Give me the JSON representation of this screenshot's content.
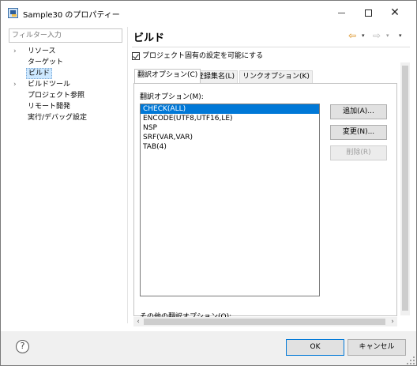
{
  "window": {
    "title": "Sample30 のプロパティー",
    "controls": {
      "minimize": "minimize-icon",
      "maximize": "maximize-icon",
      "close": "✕"
    }
  },
  "filter": {
    "placeholder": "フィルター入力"
  },
  "tree": {
    "items": [
      {
        "label": "リソース",
        "expandable": true,
        "selected": false
      },
      {
        "label": "ターゲット",
        "expandable": false,
        "selected": false
      },
      {
        "label": "ビルド",
        "expandable": false,
        "selected": true
      },
      {
        "label": "ビルドツール",
        "expandable": true,
        "selected": false
      },
      {
        "label": "プロジェクト参照",
        "expandable": false,
        "selected": false
      },
      {
        "label": "リモート開発",
        "expandable": false,
        "selected": false
      },
      {
        "label": "実行/デバッグ設定",
        "expandable": false,
        "selected": false
      }
    ]
  },
  "page": {
    "title": "ビルド",
    "nav": {
      "back": "⇦",
      "forward": "⇨",
      "dropdown": "▾"
    },
    "project_specific_checkbox": {
      "label": "プロジェクト固有の設定を可能にする",
      "checked": true
    }
  },
  "tabs": [
    {
      "label": "翻訳オプション(C)",
      "active": true
    },
    {
      "label": "登録集名(L)",
      "active": false
    },
    {
      "label": "リンクオプション(K)",
      "active": false
    }
  ],
  "options": {
    "label": "翻訳オプション(M):",
    "items": [
      {
        "text": "CHECK(ALL)",
        "selected": true
      },
      {
        "text": "ENCODE(UTF8,UTF16,LE)",
        "selected": false
      },
      {
        "text": "NSP",
        "selected": false
      },
      {
        "text": "SRF(VAR,VAR)",
        "selected": false
      },
      {
        "text": "TAB(4)",
        "selected": false
      }
    ],
    "buttons": {
      "add": "追加(A)...",
      "change": "変更(N)...",
      "delete": "削除(R)"
    },
    "other_label": "その他の翻訳オプション(O):"
  },
  "footer": {
    "help": "?",
    "ok": "OK",
    "cancel": "キャンセル"
  },
  "colors": {
    "selection": "#0078d7",
    "tree_selection": "#cde8ff",
    "back_arrow": "#d98b17"
  }
}
